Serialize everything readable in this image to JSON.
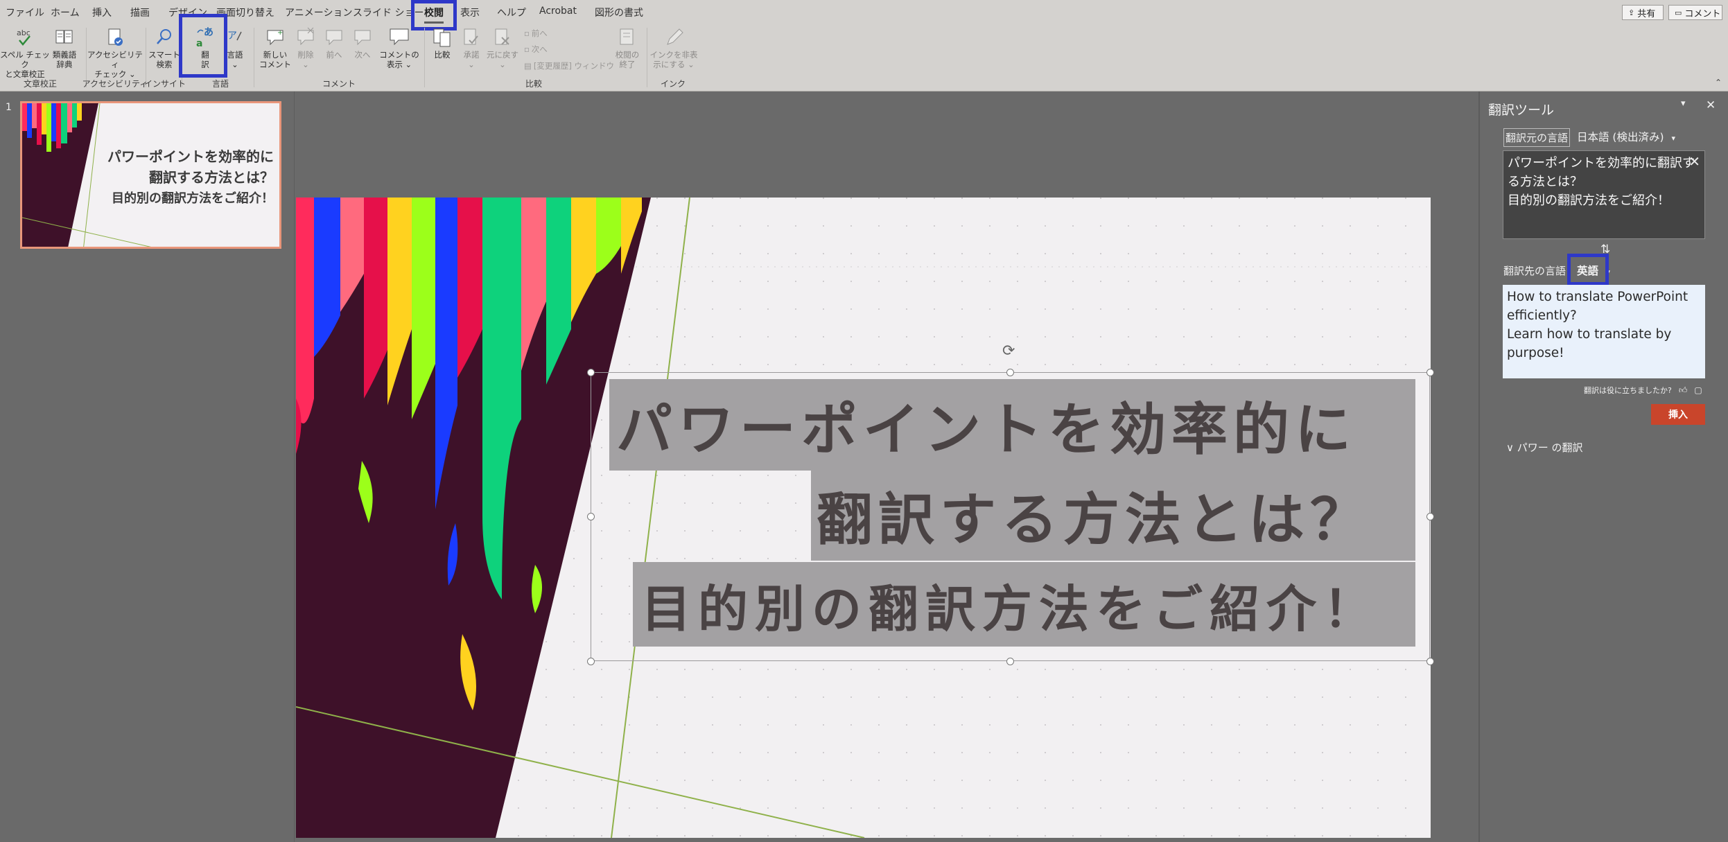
{
  "ribbon": {
    "tabs": [
      "ファイル",
      "ホーム",
      "挿入",
      "描画",
      "デザイン",
      "画面切り替え",
      "アニメーション",
      "スライド ショー",
      "校閲",
      "表示",
      "ヘルプ",
      "Acrobat",
      "図形の書式"
    ],
    "active_tab": "校閲",
    "share_label": "共有",
    "comment_label": "コメント",
    "buttons": {
      "spell": "スペル チェック\nと文章校正",
      "thesaurus": "類義語\n辞典",
      "accessibility": "アクセシビリティ\nチェック ⌄",
      "smart_lookup": "スマート\n検索",
      "translate": "翻\n訳",
      "language": "言語\n⌄",
      "new_comment": "新しい\nコメント",
      "delete": "削除\n⌄",
      "previous": "前へ",
      "next": "次へ",
      "show_comments": "コメントの\n表示 ⌄",
      "compare": "比較",
      "accept": "承諾\n⌄",
      "reject": "元に戻す\n⌄",
      "prev_change": "前へ",
      "next_change": "次へ",
      "revisions_window": "[変更履歴] ウィンドウ",
      "end_review": "校閲の\n終了",
      "hide_ink": "インクを非表\n示にする ⌄"
    },
    "groups": [
      "文章校正",
      "アクセシビリティ",
      "インサイト",
      "言語",
      "コメント",
      "比較",
      "インク"
    ]
  },
  "thumbnails": [
    {
      "number": "1",
      "line1": "パワーポイントを効率的に",
      "line2": "翻訳する方法とは？",
      "line3": "目的別の翻訳方法をご紹介！"
    }
  ],
  "slide": {
    "title_line1": "パワーポイントを効率的に",
    "title_line2": "翻訳する方法とは？",
    "subtitle": "目的別の翻訳方法をご紹介！"
  },
  "translator": {
    "title": "翻訳ツール",
    "source_label": "翻訳元の言語",
    "source_lang": "日本語 (検出済み)",
    "source_text": "パワーポイントを効率的に翻訳する方法とは？\n目的別の翻訳方法をご紹介！",
    "target_label": "翻訳先の言語",
    "target_lang": "英語",
    "target_text": "How to translate PowerPoint efficiently?\nLearn how to translate by purpose!",
    "helpful_prompt": "翻訳は役に立ちましたか?",
    "insert_label": "挿入",
    "power_section": "パワー の翻訳"
  },
  "colors": {
    "highlight": "#2e38c8",
    "insert_button": "#c9452b",
    "slide_dark": "#3e1129"
  }
}
